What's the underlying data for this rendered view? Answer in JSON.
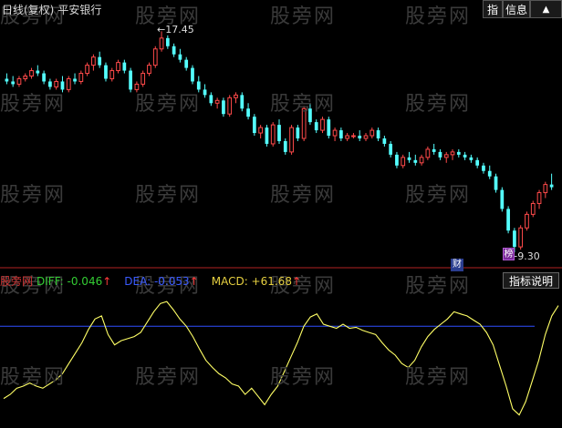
{
  "header": {
    "period": "日线(复权)",
    "stock_name": "平安银行",
    "buttons": {
      "indicator": "指",
      "info": "信息",
      "more": "▲"
    }
  },
  "watermark_text": "股旁网",
  "annotations": {
    "high_price": "17.45",
    "low_price": "9.30",
    "cai_marker": "财",
    "pi_marker": "榜"
  },
  "indicator": {
    "name": "股旁网",
    "diff_label": "DIFF: -0.046",
    "dea_label": "DEA: -0.053",
    "macd_label": "MACD: +61.68",
    "up_arrow": "↑",
    "explain_button": "指标说明"
  },
  "colors": {
    "up": "#ff4a4a",
    "down": "#54ffff",
    "diff": "#33cc33",
    "dea": "#3a5bff",
    "macd_line": "#ffff66",
    "level_line": "#2f4fff",
    "divider": "#b22222"
  },
  "chart_data": {
    "type": "candlestick",
    "candles": [
      [
        15.7,
        15.9,
        15.5,
        15.6
      ],
      [
        15.6,
        15.8,
        15.4,
        15.5
      ],
      [
        15.5,
        15.8,
        15.4,
        15.7
      ],
      [
        15.7,
        15.9,
        15.6,
        15.8
      ],
      [
        15.8,
        16.1,
        15.7,
        16.0
      ],
      [
        16.0,
        16.2,
        15.8,
        15.9
      ],
      [
        15.9,
        16.0,
        15.5,
        15.6
      ],
      [
        15.6,
        15.7,
        15.3,
        15.4
      ],
      [
        15.4,
        15.7,
        15.3,
        15.6
      ],
      [
        15.6,
        15.8,
        15.2,
        15.3
      ],
      [
        15.3,
        15.8,
        15.2,
        15.7
      ],
      [
        15.7,
        15.9,
        15.5,
        15.6
      ],
      [
        15.6,
        16.0,
        15.5,
        15.9
      ],
      [
        15.9,
        16.3,
        15.8,
        16.2
      ],
      [
        16.2,
        16.6,
        16.0,
        16.5
      ],
      [
        16.5,
        16.7,
        16.1,
        16.2
      ],
      [
        16.2,
        16.3,
        15.6,
        15.7
      ],
      [
        15.7,
        16.1,
        15.6,
        16.0
      ],
      [
        16.0,
        16.4,
        15.9,
        16.3
      ],
      [
        16.3,
        16.4,
        15.9,
        16.0
      ],
      [
        16.0,
        16.1,
        15.2,
        15.3
      ],
      [
        15.3,
        15.6,
        15.2,
        15.5
      ],
      [
        15.5,
        16.0,
        15.4,
        15.9
      ],
      [
        15.9,
        16.3,
        15.8,
        16.2
      ],
      [
        16.2,
        16.9,
        16.1,
        16.8
      ],
      [
        16.8,
        17.45,
        16.7,
        17.2
      ],
      [
        17.2,
        17.3,
        16.8,
        16.9
      ],
      [
        16.9,
        17.0,
        16.5,
        16.6
      ],
      [
        16.6,
        16.8,
        16.3,
        16.4
      ],
      [
        16.4,
        16.5,
        16.0,
        16.1
      ],
      [
        16.1,
        16.2,
        15.5,
        15.6
      ],
      [
        15.6,
        15.8,
        15.2,
        15.3
      ],
      [
        15.3,
        15.5,
        15.0,
        15.1
      ],
      [
        15.1,
        15.2,
        14.7,
        14.8
      ],
      [
        14.8,
        15.0,
        14.6,
        14.9
      ],
      [
        14.9,
        15.0,
        14.3,
        14.4
      ],
      [
        14.4,
        15.1,
        14.3,
        15.0
      ],
      [
        15.0,
        15.2,
        14.8,
        15.1
      ],
      [
        15.1,
        15.2,
        14.5,
        14.6
      ],
      [
        14.6,
        14.8,
        14.2,
        14.3
      ],
      [
        14.3,
        14.4,
        13.6,
        13.7
      ],
      [
        13.7,
        14.0,
        13.5,
        13.9
      ],
      [
        13.9,
        14.0,
        13.2,
        13.3
      ],
      [
        13.3,
        14.1,
        13.2,
        14.0
      ],
      [
        14.0,
        14.2,
        13.3,
        13.4
      ],
      [
        13.4,
        13.5,
        12.9,
        13.0
      ],
      [
        13.0,
        14.0,
        12.9,
        13.9
      ],
      [
        13.9,
        14.0,
        13.4,
        13.5
      ],
      [
        13.5,
        14.7,
        13.4,
        14.6
      ],
      [
        14.6,
        14.8,
        14.0,
        14.1
      ],
      [
        14.1,
        14.2,
        13.7,
        13.8
      ],
      [
        13.8,
        14.3,
        13.7,
        14.2
      ],
      [
        14.2,
        14.3,
        13.5,
        13.6
      ],
      [
        13.6,
        13.9,
        13.4,
        13.8
      ],
      [
        13.8,
        13.9,
        13.4,
        13.5
      ],
      [
        13.5,
        13.7,
        13.4,
        13.6
      ],
      [
        13.6,
        13.7,
        13.5,
        13.6
      ],
      [
        13.6,
        13.8,
        13.4,
        13.5
      ],
      [
        13.5,
        13.7,
        13.4,
        13.6
      ],
      [
        13.6,
        13.9,
        13.5,
        13.8
      ],
      [
        13.8,
        13.9,
        13.4,
        13.5
      ],
      [
        13.5,
        13.6,
        13.2,
        13.3
      ],
      [
        13.3,
        13.4,
        12.8,
        12.9
      ],
      [
        12.9,
        13.0,
        12.4,
        12.5
      ],
      [
        12.5,
        12.9,
        12.4,
        12.8
      ],
      [
        12.8,
        13.0,
        12.6,
        12.7
      ],
      [
        12.7,
        12.9,
        12.5,
        12.6
      ],
      [
        12.6,
        12.9,
        12.5,
        12.8
      ],
      [
        12.8,
        13.2,
        12.7,
        13.1
      ],
      [
        13.1,
        13.3,
        12.9,
        13.0
      ],
      [
        13.0,
        13.1,
        12.7,
        12.8
      ],
      [
        12.8,
        13.0,
        12.6,
        12.9
      ],
      [
        12.9,
        13.1,
        12.7,
        13.0
      ],
      [
        13.0,
        13.1,
        12.8,
        12.9
      ],
      [
        12.9,
        13.0,
        12.7,
        12.8
      ],
      [
        12.8,
        12.9,
        12.6,
        12.7
      ],
      [
        12.7,
        12.8,
        12.4,
        12.5
      ],
      [
        12.5,
        12.6,
        12.2,
        12.3
      ],
      [
        12.3,
        12.5,
        12.0,
        12.1
      ],
      [
        12.1,
        12.2,
        11.5,
        11.6
      ],
      [
        11.6,
        11.7,
        10.8,
        10.9
      ],
      [
        10.9,
        11.0,
        10.0,
        10.1
      ],
      [
        10.1,
        10.2,
        9.3,
        9.5
      ],
      [
        9.5,
        10.3,
        9.4,
        10.2
      ],
      [
        10.2,
        10.8,
        10.1,
        10.7
      ],
      [
        10.7,
        11.2,
        10.6,
        11.1
      ],
      [
        11.1,
        11.6,
        10.9,
        11.5
      ],
      [
        11.5,
        11.9,
        11.3,
        11.8
      ],
      [
        11.8,
        12.2,
        11.6,
        11.7
      ]
    ],
    "price_range": [
      9.0,
      18.0
    ],
    "macd_line": [
      0.18,
      0.22,
      0.28,
      0.3,
      0.33,
      0.3,
      0.28,
      0.32,
      0.36,
      0.42,
      0.52,
      0.62,
      0.72,
      0.85,
      0.95,
      0.98,
      0.8,
      0.7,
      0.74,
      0.76,
      0.78,
      0.82,
      0.92,
      1.02,
      1.1,
      1.12,
      1.04,
      0.95,
      0.88,
      0.78,
      0.66,
      0.55,
      0.48,
      0.42,
      0.38,
      0.32,
      0.3,
      0.22,
      0.28,
      0.2,
      0.12,
      0.22,
      0.3,
      0.44,
      0.58,
      0.72,
      0.88,
      0.97,
      1.0,
      0.9,
      0.88,
      0.86,
      0.9,
      0.86,
      0.87,
      0.84,
      0.82,
      0.8,
      0.72,
      0.65,
      0.6,
      0.52,
      0.48,
      0.55,
      0.68,
      0.78,
      0.85,
      0.9,
      0.95,
      1.02,
      1.0,
      0.98,
      0.94,
      0.9,
      0.82,
      0.7,
      0.5,
      0.3,
      0.08,
      0.02,
      0.15,
      0.35,
      0.55,
      0.8,
      0.98,
      1.08
    ],
    "level": 0.88,
    "macd_range": [
      0.0,
      1.2
    ]
  }
}
